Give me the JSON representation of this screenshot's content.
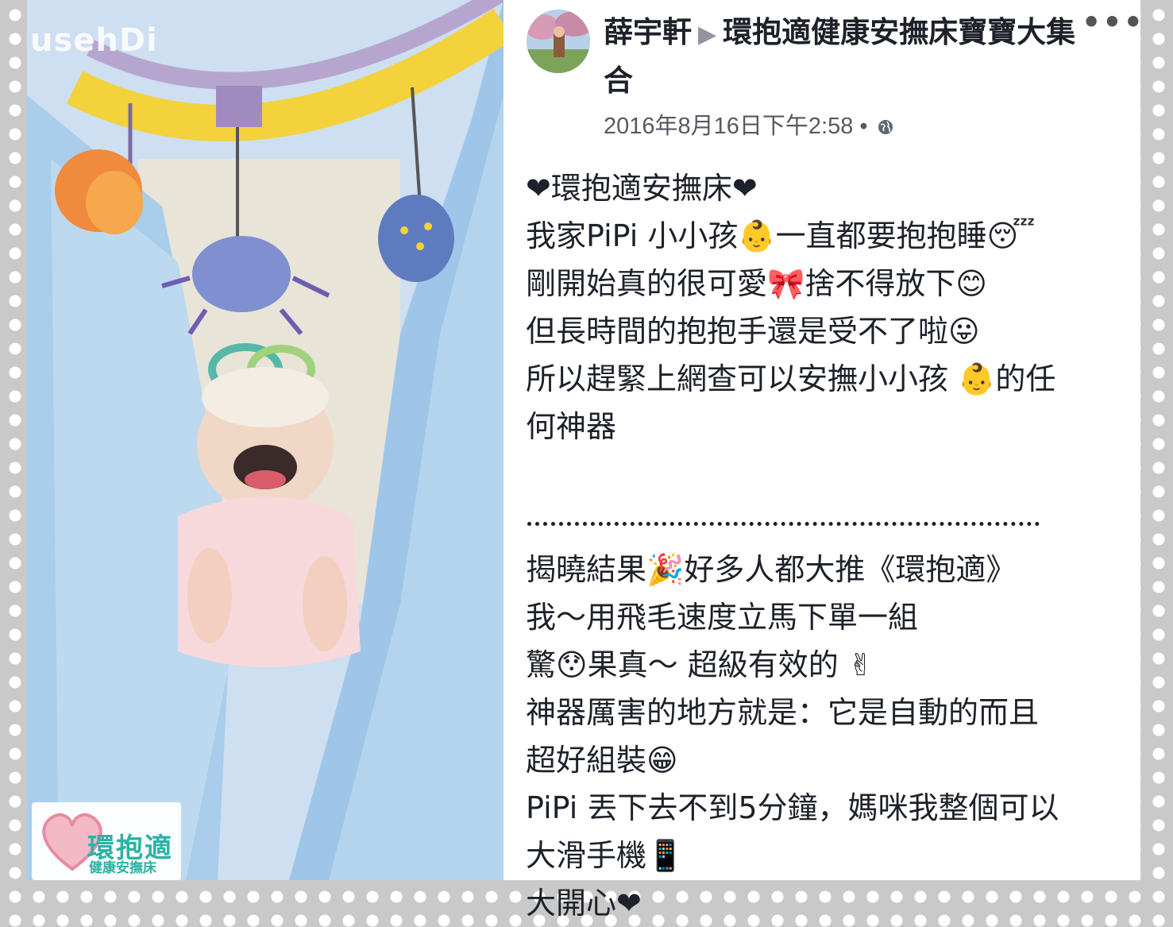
{
  "photo": {
    "watermark": "usehDi",
    "brand": {
      "name": "環抱適",
      "subtitle": "健康安撫床"
    }
  },
  "post": {
    "author": "薛宇軒",
    "arrow": "▶",
    "group": "環抱適健康安撫床寶寶大集合",
    "more_icon": "•••",
    "timestamp": "2016年8月16日下午2:58",
    "separator": "•",
    "privacy_icon": "globe-icon",
    "lines": [
      "❤環抱適安撫床❤",
      "我家PiPi 小小孩👶一直都要抱抱睡😴",
      "剛開始真的很可愛🎀捨不得放下😊",
      "但長時間的抱抱手還是受不了啦😛",
      "所以趕緊上網查可以安撫小小孩 👶的任",
      "何神器",
      "",
      "",
      "揭曉結果🎉好多人都大推《環抱適》",
      "我～用飛毛速度立馬下單一組",
      "驚😯果真～ 超級有效的 ✌",
      "神器厲害的地方就是：它是自動的而且",
      "超好組裝😁",
      "PiPi 丟下去不到5分鐘，媽咪我整個可以",
      "大滑手機📱",
      "大開心❤"
    ]
  },
  "colors": {
    "text": "#1d2129",
    "meta": "#555a60",
    "brand": "#2bb3a3",
    "heart": "#e0294a"
  }
}
